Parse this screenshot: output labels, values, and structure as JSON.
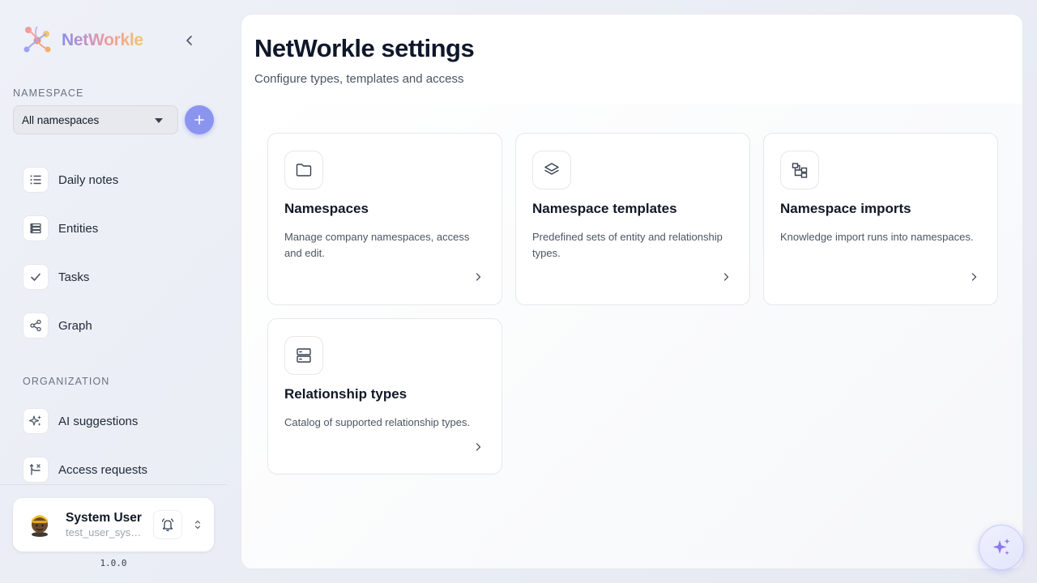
{
  "brand": {
    "name": "NetWorkle"
  },
  "sidebar": {
    "namespace_label": "NAMESPACE",
    "namespace_selected": "All namespaces",
    "nav": [
      {
        "label": "Daily notes",
        "icon": "list-icon"
      },
      {
        "label": "Entities",
        "icon": "database-list-icon"
      },
      {
        "label": "Tasks",
        "icon": "check-icon"
      },
      {
        "label": "Graph",
        "icon": "share-icon"
      }
    ],
    "organization_label": "ORGANIZATION",
    "org_nav": [
      {
        "label": "AI suggestions",
        "icon": "sparkles-icon"
      },
      {
        "label": "Access requests",
        "icon": "git-merge-icon"
      }
    ],
    "user": {
      "name": "System User",
      "email": "test_user_system@networkle.local"
    },
    "version": "1.0.0"
  },
  "main": {
    "title": "NetWorkle settings",
    "subtitle": "Configure types, templates and access",
    "cards": [
      {
        "title": "Namespaces",
        "description": "Manage company namespaces, access and edit.",
        "icon": "folder-icon"
      },
      {
        "title": "Namespace templates",
        "description": "Predefined sets of entity and relationship types.",
        "icon": "layers-icon"
      },
      {
        "title": "Namespace imports",
        "description": "Knowledge import runs into namespaces.",
        "icon": "hierarchy-icon"
      },
      {
        "title": "Relationship types",
        "description": "Catalog of supported relationship types.",
        "icon": "server-icon"
      }
    ]
  },
  "colors": {
    "accent": "#8b95f0",
    "brand_gradient": [
      "#8b8cf0",
      "#f09aa0",
      "#f3c56b"
    ]
  }
}
